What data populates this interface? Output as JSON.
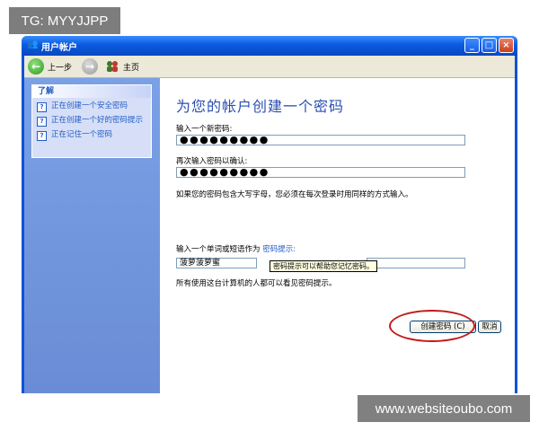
{
  "watermarks": {
    "top": "TG: MYYJJPP",
    "bottom": "www.websiteoubo.com"
  },
  "window": {
    "title": "用户帐户",
    "min_glyph": "_",
    "max_glyph": "□",
    "close_glyph": "×"
  },
  "toolbar": {
    "back_label": "上一步",
    "home_label": "主页",
    "back_glyph": "←",
    "fwd_glyph": "→"
  },
  "sidebar": {
    "header": "了解",
    "items": [
      {
        "label": "正在创建一个安全密码"
      },
      {
        "label": "正在创建一个好的密码提示"
      },
      {
        "label": "正在记住一个密码"
      }
    ],
    "item_icon_glyph": "?"
  },
  "main": {
    "title": "为您的帐户创建一个密码",
    "new_password_label": "输入一个新密码:",
    "new_password_value": "●●●●●●●●●",
    "confirm_label": "再次输入密码以确认:",
    "confirm_value": "●●●●●●●●●",
    "case_note": "如果您的密码包含大写字母，您必须在每次登录时用同样的方式输入。",
    "hint_label": "输入一个单词或短语作为",
    "hint_link": "密码提示:",
    "hint_value": "菠萝菠萝蜜",
    "tooltip": "密码提示可以帮助您记忆密码。",
    "visibility_note": "所有使用这台计算机的人都可以看见密码提示。",
    "create_button": "创建密码 (C)",
    "cancel_button": "取消"
  },
  "colors": {
    "title_bar": "#0a5ae0",
    "sidebar_bg": "#7aa1e6",
    "title_text": "#2a4fb0",
    "link": "#215dc6",
    "highlight_ellipse": "#c21a1a"
  }
}
